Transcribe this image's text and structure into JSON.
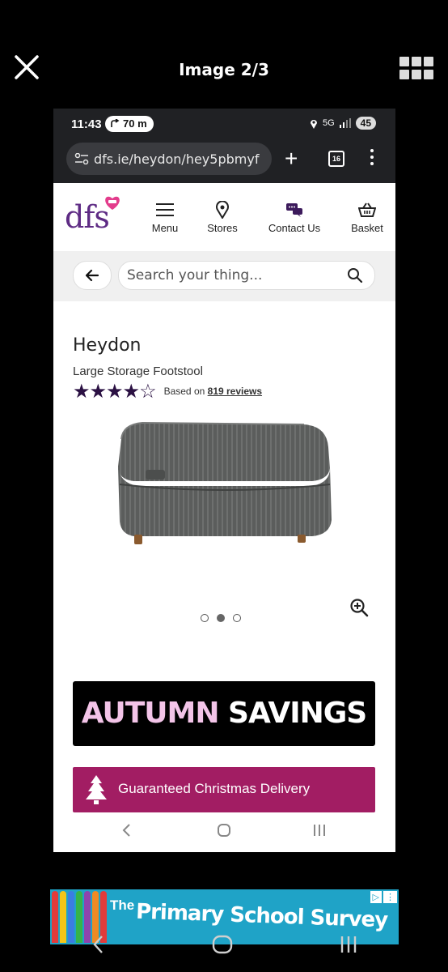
{
  "viewer": {
    "title": "Image 2/3"
  },
  "status": {
    "time": "11:43",
    "distance": "70 m",
    "network": "5G",
    "battery": "45"
  },
  "browser": {
    "url": "dfs.ie/heydon/hey5pbmyf",
    "tabs_count": "16"
  },
  "site": {
    "logo": "dfs",
    "nav": [
      {
        "label": "Menu"
      },
      {
        "label": "Stores"
      },
      {
        "label": "Contact Us"
      },
      {
        "label": "Basket"
      }
    ],
    "search_placeholder": "Search your thing..."
  },
  "product": {
    "name": "Heydon",
    "subtitle": "Large Storage Footstool",
    "rating": 4.5,
    "stars": "★★★★☆",
    "based_on": "Based on",
    "reviews": "819 reviews",
    "image_count": 3,
    "active_image": 2
  },
  "banners": {
    "autumn_1": "AUTUMN",
    "autumn_2": "SAVINGS",
    "christmas": "Guaranteed Christmas Delivery"
  },
  "ad": {
    "the": "The",
    "text": "Primary School Survey"
  },
  "colors": {
    "brand": "#5e2b84",
    "christmas": "#a21d63",
    "autumn_pink": "#f3c4e8",
    "ad_bg": "#1fa3c7"
  }
}
